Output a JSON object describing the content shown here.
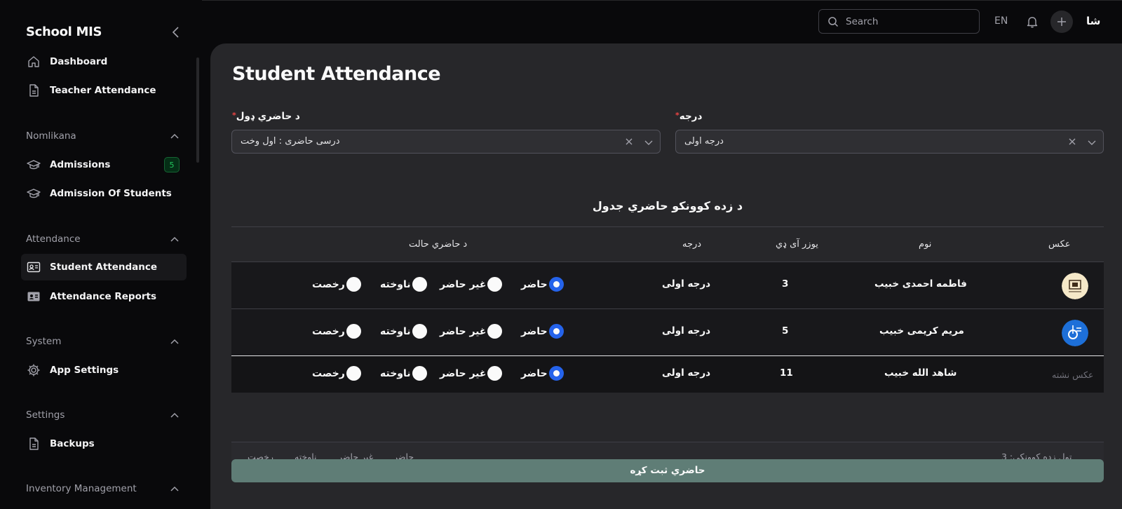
{
  "app": {
    "title": "School MIS"
  },
  "topbar": {
    "search_placeholder": "Search",
    "language": "EN",
    "user_initials": "شا"
  },
  "sidebar": {
    "top_items": [
      {
        "label": "Dashboard",
        "icon": "home-icon"
      },
      {
        "label": "Teacher Attendance",
        "icon": "file-icon"
      }
    ],
    "groups": [
      {
        "label": "Nomlikana",
        "items": [
          {
            "label": "Admissions",
            "icon": "graduation-cap-icon",
            "badge": "5"
          },
          {
            "label": "Admission Of Students",
            "icon": "graduation-cap-icon"
          }
        ]
      },
      {
        "label": "Attendance",
        "items": [
          {
            "label": "Student Attendance",
            "icon": "id-card-icon",
            "active": true
          },
          {
            "label": "Attendance Reports",
            "icon": "id-card-icon"
          }
        ]
      },
      {
        "label": "System",
        "items": [
          {
            "label": "App Settings",
            "icon": "gear-icon"
          }
        ]
      },
      {
        "label": "Settings",
        "items": [
          {
            "label": "Backups",
            "icon": "file-icon"
          }
        ]
      },
      {
        "label": "Inventory Management",
        "items": []
      }
    ]
  },
  "page": {
    "title": "Student Attendance",
    "filters": {
      "period": {
        "label": "د حاضري ډول",
        "value": "درسی حاضری : اول وخت"
      },
      "grade": {
        "label": "درجه",
        "value": "درجه اولی"
      }
    },
    "table": {
      "title": "د زده کوونکو حاضري جدول",
      "headers": {
        "photo": "عکس",
        "name": "نوم",
        "user_id": "یوزر آی ډي",
        "grade": "درجه",
        "status": "د حاضري حالت"
      },
      "status_options": [
        "حاضر",
        "غیر حاضر",
        "ناوخته",
        "رخصت"
      ],
      "rows": [
        {
          "name": "فاطمه احمدی خبیب",
          "user_id": "3",
          "grade": "درجه اولی",
          "status": "حاضر",
          "photo": "logo-a"
        },
        {
          "name": "مریم کریمی خبیب",
          "user_id": "5",
          "grade": "درجه اولی",
          "status": "حاضر",
          "photo": "logo-b"
        },
        {
          "name": "شاهد الله خبیب",
          "user_id": "11",
          "grade": "درجه اولی",
          "status": "حاضر",
          "photo": "none",
          "photo_text": "عکس نشته"
        }
      ],
      "footer": {
        "total": "ټول زده کوونکي: 3",
        "present": "حاضر",
        "absent": "غیر حاضر",
        "late": "ناوخته",
        "leave": "رخصت"
      }
    },
    "submit_label": "حاضري ثبت کړه"
  },
  "colors": {
    "accent": "#2563eb",
    "submit": "#5f7d76",
    "badge": "#22c55e"
  }
}
